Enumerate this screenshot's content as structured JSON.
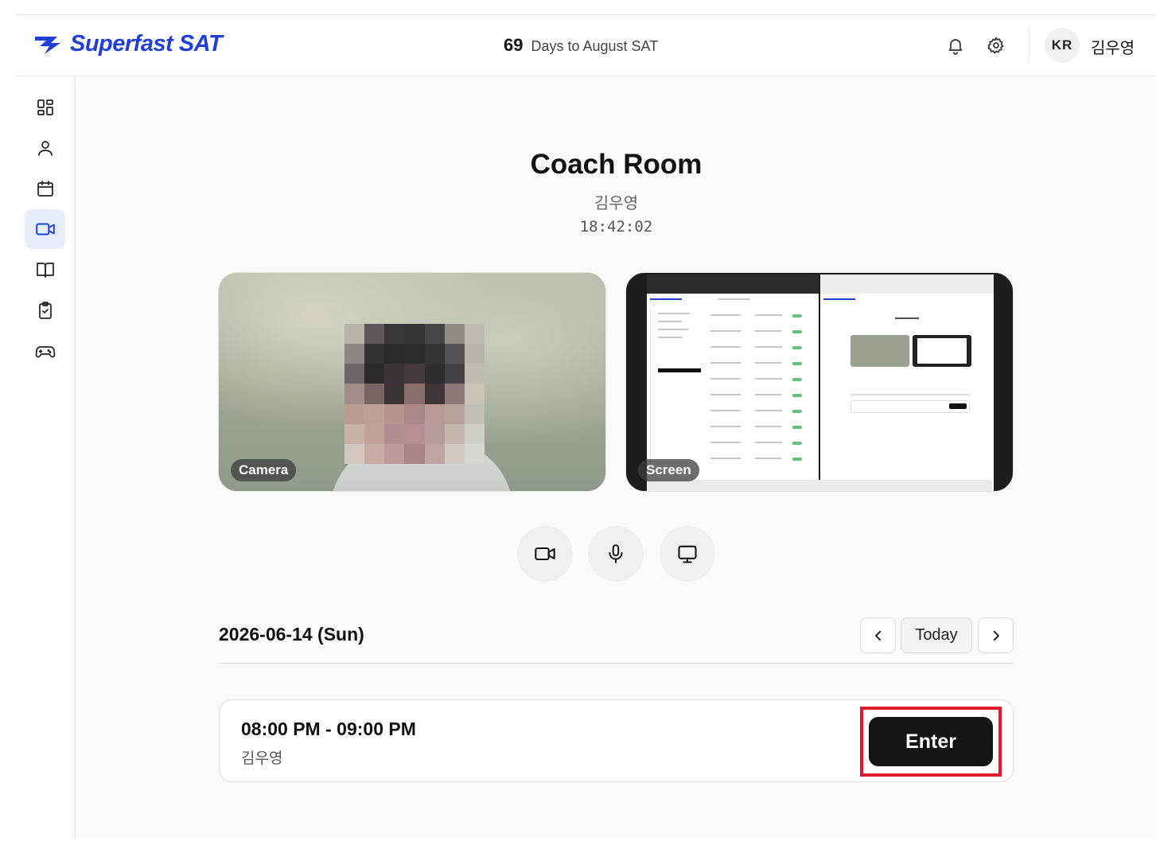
{
  "brand": {
    "name": "Superfast SAT",
    "color": "#1f3fd6"
  },
  "header": {
    "countdown_number": "69",
    "countdown_text": "Days to August SAT",
    "language": "KR",
    "user_name": "김우영",
    "icons": [
      "bell-icon",
      "gear-icon"
    ]
  },
  "sidebar": {
    "items": [
      {
        "name": "dashboard",
        "icon": "grid-icon",
        "active": false
      },
      {
        "name": "profile",
        "icon": "user-icon",
        "active": false
      },
      {
        "name": "calendar",
        "icon": "calendar-icon",
        "active": false
      },
      {
        "name": "coach-room",
        "icon": "video-icon",
        "active": true
      },
      {
        "name": "book",
        "icon": "book-icon",
        "active": false
      },
      {
        "name": "tasks",
        "icon": "clipboard-check-icon",
        "active": false
      },
      {
        "name": "games",
        "icon": "gamepad-icon",
        "active": false
      }
    ]
  },
  "main": {
    "title": "Coach Room",
    "name": "김우영",
    "clock": "18:42:02",
    "camera_label": "Camera",
    "screen_label": "Screen",
    "controls": [
      "camera-toggle",
      "mic-toggle",
      "screen-share-toggle"
    ]
  },
  "schedule": {
    "date": "2026-06-14 (Sun)",
    "prev_label": "‹",
    "today_label": "Today",
    "next_label": "›",
    "sessions": [
      {
        "time": "08:00 PM - 09:00 PM",
        "name": "김우영",
        "action": "Enter"
      }
    ]
  },
  "colors": {
    "active_nav_bg": "#e7edfb",
    "highlight": "#e01a2c",
    "enter_bg": "#141414"
  }
}
